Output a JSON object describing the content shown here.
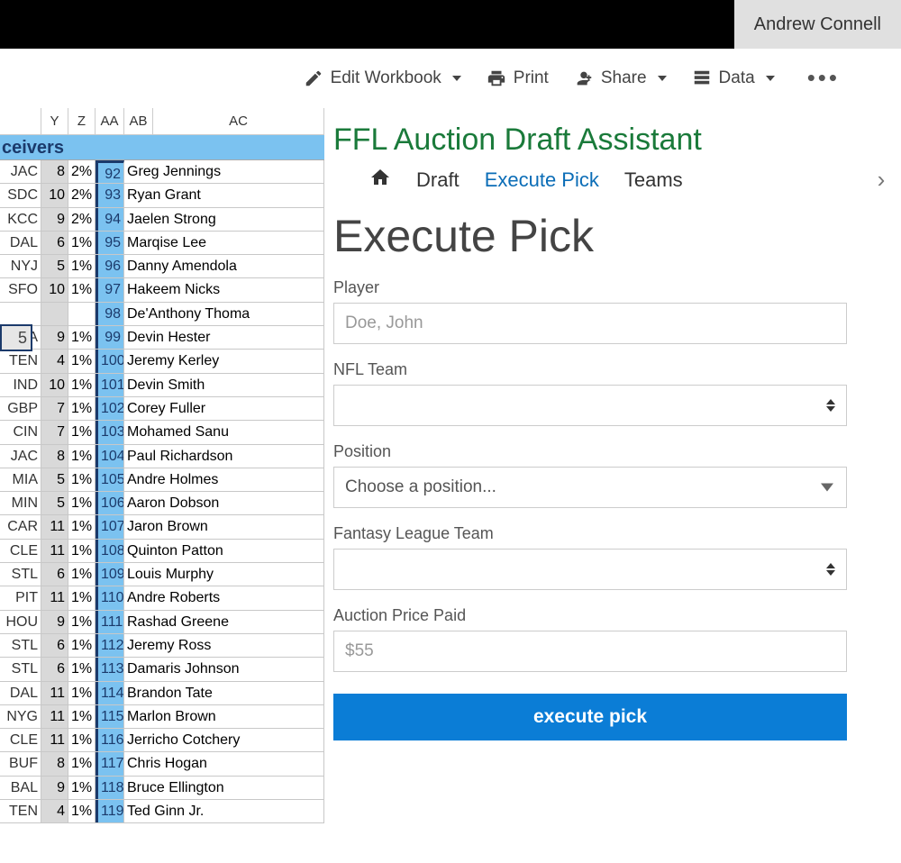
{
  "user": {
    "name": "Andrew Connell"
  },
  "toolbar": {
    "edit": "Edit Workbook",
    "print": "Print",
    "share": "Share",
    "data": "Data"
  },
  "columns": [
    "Y",
    "Z",
    "AA",
    "AB",
    "AC"
  ],
  "section_header": "ceivers",
  "left_row_label": "5",
  "sheet_rows": [
    {
      "team": "JAC",
      "a": "8",
      "b": "2%",
      "idx": "92",
      "name": "Greg Jennings"
    },
    {
      "team": "SDC",
      "a": "10",
      "b": "2%",
      "idx": "93",
      "name": "Ryan Grant"
    },
    {
      "team": "KCC",
      "a": "9",
      "b": "2%",
      "idx": "94",
      "name": "Jaelen Strong"
    },
    {
      "team": "DAL",
      "a": "6",
      "b": "1%",
      "idx": "95",
      "name": "Marqise Lee"
    },
    {
      "team": "NYJ",
      "a": "5",
      "b": "1%",
      "idx": "96",
      "name": "Danny Amendola"
    },
    {
      "team": "SFO",
      "a": "10",
      "b": "1%",
      "idx": "97",
      "name": "Hakeem Nicks"
    },
    {
      "team": "",
      "a": "",
      "b": "",
      "idx": "98",
      "name": "De'Anthony Thoma"
    },
    {
      "team": "SEA",
      "a": "9",
      "b": "1%",
      "idx": "99",
      "name": "Devin Hester"
    },
    {
      "team": "TEN",
      "a": "4",
      "b": "1%",
      "idx": "100",
      "name": "Jeremy Kerley"
    },
    {
      "team": "IND",
      "a": "10",
      "b": "1%",
      "idx": "101",
      "name": "Devin Smith"
    },
    {
      "team": "GBP",
      "a": "7",
      "b": "1%",
      "idx": "102",
      "name": "Corey Fuller"
    },
    {
      "team": "CIN",
      "a": "7",
      "b": "1%",
      "idx": "103",
      "name": "Mohamed Sanu"
    },
    {
      "team": "JAC",
      "a": "8",
      "b": "1%",
      "idx": "104",
      "name": "Paul Richardson"
    },
    {
      "team": "MIA",
      "a": "5",
      "b": "1%",
      "idx": "105",
      "name": "Andre Holmes"
    },
    {
      "team": "MIN",
      "a": "5",
      "b": "1%",
      "idx": "106",
      "name": "Aaron Dobson"
    },
    {
      "team": "CAR",
      "a": "11",
      "b": "1%",
      "idx": "107",
      "name": "Jaron Brown"
    },
    {
      "team": "CLE",
      "a": "11",
      "b": "1%",
      "idx": "108",
      "name": "Quinton Patton"
    },
    {
      "team": "STL",
      "a": "6",
      "b": "1%",
      "idx": "109",
      "name": "Louis Murphy"
    },
    {
      "team": "PIT",
      "a": "11",
      "b": "1%",
      "idx": "110",
      "name": "Andre Roberts"
    },
    {
      "team": "HOU",
      "a": "9",
      "b": "1%",
      "idx": "111",
      "name": "Rashad Greene"
    },
    {
      "team": "STL",
      "a": "6",
      "b": "1%",
      "idx": "112",
      "name": "Jeremy Ross"
    },
    {
      "team": "STL",
      "a": "6",
      "b": "1%",
      "idx": "113",
      "name": "Damaris Johnson"
    },
    {
      "team": "DAL",
      "a": "11",
      "b": "1%",
      "idx": "114",
      "name": "Brandon Tate"
    },
    {
      "team": "NYG",
      "a": "11",
      "b": "1%",
      "idx": "115",
      "name": "Marlon Brown"
    },
    {
      "team": "CLE",
      "a": "11",
      "b": "1%",
      "idx": "116",
      "name": "Jerricho Cotchery"
    },
    {
      "team": "BUF",
      "a": "8",
      "b": "1%",
      "idx": "117",
      "name": "Chris Hogan"
    },
    {
      "team": "BAL",
      "a": "9",
      "b": "1%",
      "idx": "118",
      "name": "Bruce Ellington"
    },
    {
      "team": "TEN",
      "a": "4",
      "b": "1%",
      "idx": "119",
      "name": "Ted Ginn Jr."
    }
  ],
  "app": {
    "title": "FFL Auction Draft Assistant",
    "nav": {
      "draft": "Draft",
      "execute": "Execute Pick",
      "teams": "Teams"
    },
    "heading": "Execute Pick",
    "fields": {
      "player_label": "Player",
      "player_placeholder": "Doe, John",
      "nflteam_label": "NFL Team",
      "position_label": "Position",
      "position_placeholder": "Choose a position...",
      "fantasy_label": "Fantasy League Team",
      "price_label": "Auction Price Paid",
      "price_placeholder": "$55"
    },
    "button": "execute pick"
  }
}
